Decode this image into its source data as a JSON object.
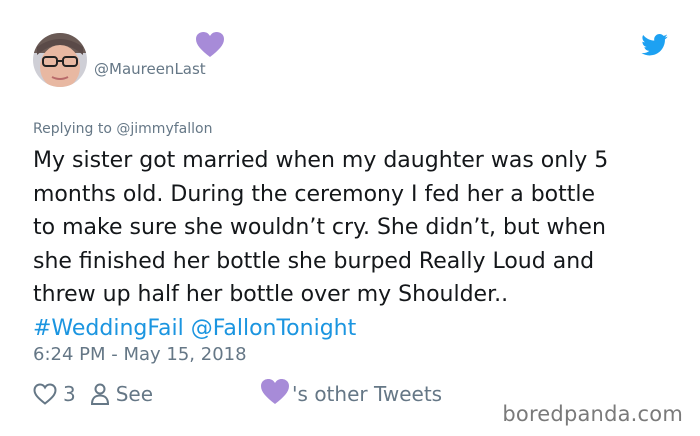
{
  "tweet": {
    "handle": "@MaureenLast",
    "replying_prefix": "Replying to ",
    "replying_to": "@jimmyfallon",
    "text_lines": [
      "My sister got married when my daughter was only 5",
      "months old. During the ceremony I fed her a bottle",
      "to make sure she wouldn’t cry. She didn’t, but when",
      "she finished her bottle she burped Really Loud and",
      "threw up half her bottle over my Shoulder.."
    ],
    "hashtag": "#WeddingFail",
    "mention": "@FallonTonight",
    "timestamp": "6:24 PM - May 15, 2018",
    "like_count": "3",
    "see_label": "See",
    "other_tweets_label": "'s other Tweets"
  },
  "icons": {
    "avatar": "avatar",
    "heart": "heart-icon",
    "twitter": "twitter-bird-icon",
    "like": "like-heart-icon",
    "person": "person-icon"
  },
  "colors": {
    "link": "#1b95e0",
    "muted": "#657786",
    "text": "#14171a",
    "heart_purple": "#a78bd8",
    "twitter_blue": "#1da1f2"
  },
  "watermark": "boredpanda.com"
}
